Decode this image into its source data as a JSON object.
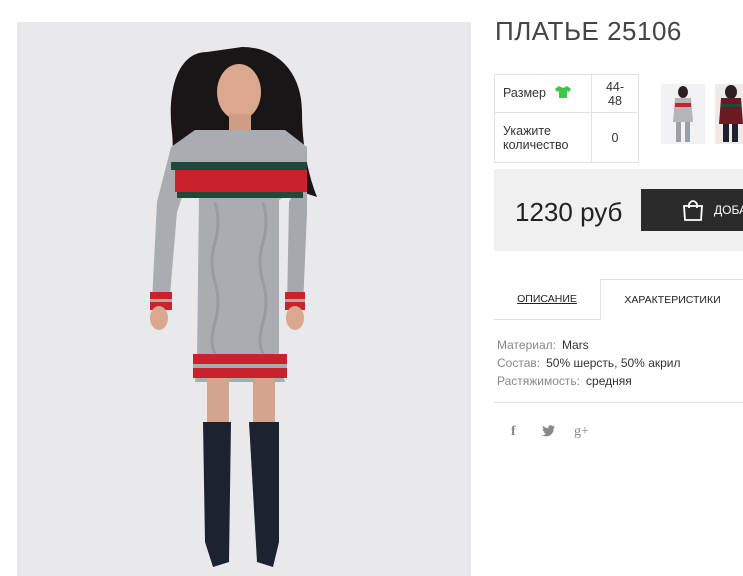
{
  "product": {
    "title": "ПЛАТЬЕ 25106",
    "size_label": "Размер",
    "size_value": "44-48",
    "size_icon": "tshirt-icon",
    "qty_label": "Укажите количество",
    "qty_value": "0",
    "price": "1230 руб",
    "add_to_cart_label": "ДОБА"
  },
  "tabs": [
    {
      "label": "ОПИСАНИЕ"
    },
    {
      "label": "ХАРАКТЕРИСТИКИ",
      "active": true
    }
  ],
  "characteristics": [
    {
      "key": "Материал:",
      "value": "Mars"
    },
    {
      "key": "Состав:",
      "value": "50% шерсть, 50% акрил"
    },
    {
      "key": "Растяжимость:",
      "value": "средняя"
    }
  ],
  "social": {
    "facebook": "f",
    "twitter": "twitter-icon",
    "googleplus": "g+"
  },
  "colors": {
    "accent_green": "#3cc84a",
    "button_dark": "#2b2b2b",
    "stripe_red": "#c8232c",
    "stripe_green": "#1f4a3a",
    "dress_grey": "#a9acb0"
  }
}
